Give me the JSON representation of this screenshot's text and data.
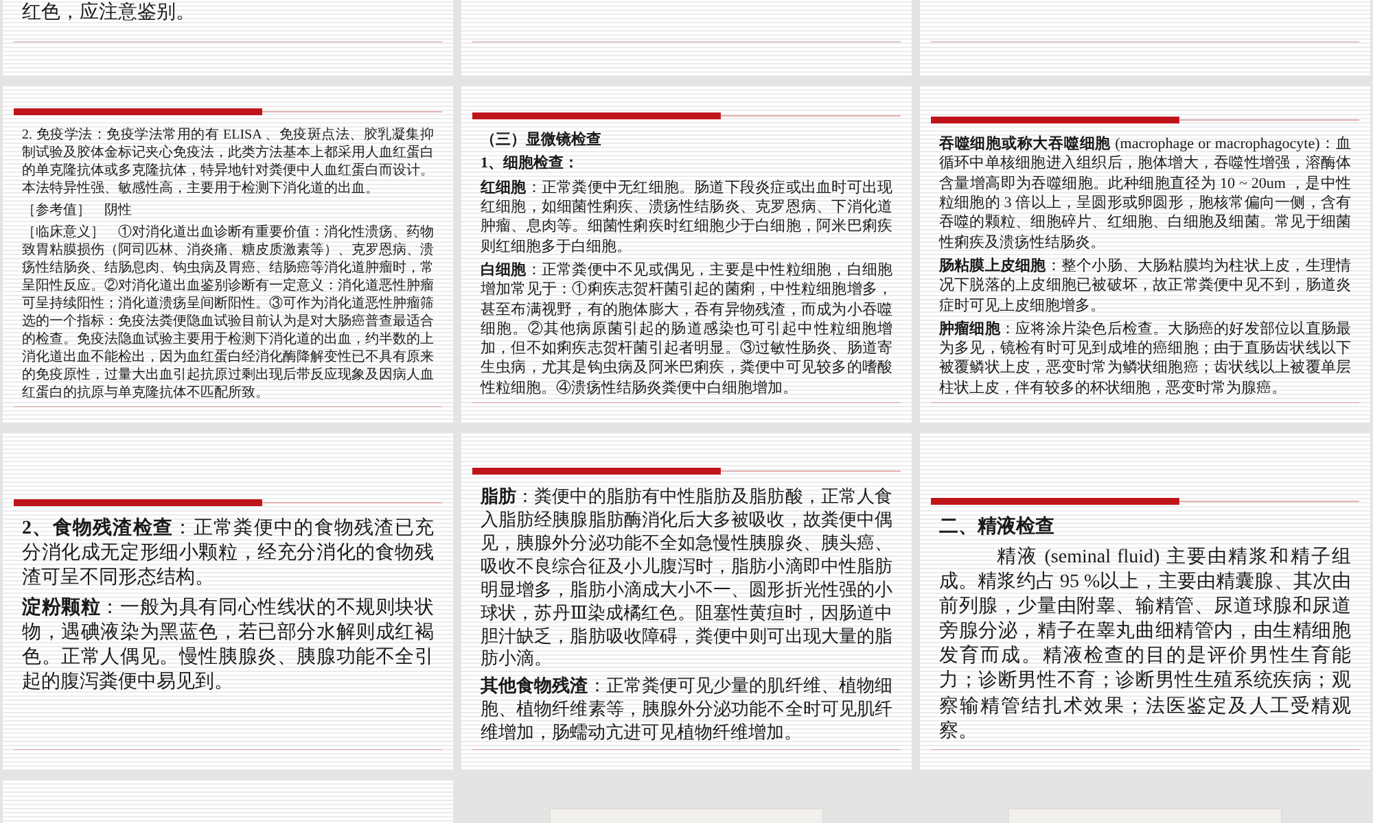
{
  "slides": [
    {
      "kind": "continued",
      "blocks": [
        {
          "kind": "para",
          "text": "红色，应注意鉴别。"
        }
      ]
    },
    {
      "kind": "blank"
    },
    {
      "kind": "blank"
    },
    {
      "kind": "text",
      "blocks": [
        {
          "kind": "para",
          "text": "2. 免疫学法：免疫学法常用的有 ELISA 、免疫斑点法、胶乳凝集抑制试验及胶体金标记夹心免疫法，此类方法基本上都采用人血红蛋白的单克隆抗体或多克隆抗体，特异地针对粪便中人血红蛋白而设计。本法特异性强、敏感性高，主要用于检测下消化道的出血。"
        },
        {
          "kind": "para",
          "text": "［参考值］　阴性"
        },
        {
          "kind": "para",
          "text": "［临床意义］　①对消化道出血诊断有重要价值：消化性溃疡、药物致胃粘膜损伤（阿司匹林、消炎痛、糖皮质激素等）、克罗恩病、溃疡性结肠炎、结肠息肉、钩虫病及胃癌、结肠癌等消化道肿瘤时，常呈阳性反应。②对消化道出血鉴别诊断有一定意义：消化道恶性肿瘤可呈持续阳性；消化道溃疡呈间断阳性。③可作为消化道恶性肿瘤筛选的一个指标：免疫法粪便隐血试验目前认为是对大肠癌普查最适合的检查。免疫法隐血试验主要用于检测下消化道的出血，约半数的上消化道出血不能检出，因为血红蛋白经消化酶降解变性已不具有原来的免疫原性，过量大出血引起抗原过剩出现后带反应现象及因病人血红蛋白的抗原与单克隆抗体不匹配所致。"
        }
      ]
    },
    {
      "kind": "text",
      "blocks": [
        {
          "kind": "heading",
          "text": "（三）显微镜检查"
        },
        {
          "kind": "heading",
          "text": "1、细胞检查："
        },
        {
          "kind": "para",
          "text": "**红细胞**：正常粪便中无红细胞。肠道下段炎症或出血时可出现红细胞，如细菌性痢疾、溃疡性结肠炎、克罗恩病、下消化道肿瘤、息肉等。细菌性痢疾时红细胞少于白细胞，阿米巴痢疾则红细胞多于白细胞。"
        },
        {
          "kind": "para",
          "text": "**白细胞**：正常粪便中不见或偶见，主要是中性粒细胞，白细胞增加常见于：①痢疾志贺杆菌引起的菌痢，中性粒细胞增多，甚至布满视野，有的胞体膨大，吞有异物残渣，而成为小吞噬细胞。②其他病原菌引起的肠道感染也可引起中性粒细胞增加，但不如痢疾志贺杆菌引起者明显。③过敏性肠炎、肠道寄生虫病，尤其是钩虫病及阿米巴痢疾，粪便中可见较多的嗜酸性粒细胞。④溃疡性结肠炎粪便中白细胞增加。"
        }
      ]
    },
    {
      "kind": "text",
      "blocks": [
        {
          "kind": "para",
          "text": "**吞噬细胞或称大吞噬细胞** (macrophage or macrophagocyte)：血循环中单核细胞进入组织后，胞体增大，吞噬性增强，溶酶体含量增高即为吞噬细胞。此种细胞直径为 10 ~ 20um ，是中性粒细胞的 3 倍以上，呈圆形或卵圆形，胞核常偏向一侧，含有吞噬的颗粒、细胞碎片、红细胞、白细胞及细菌。常见于细菌性痢疾及溃疡性结肠炎。"
        },
        {
          "kind": "para",
          "text": "**肠粘膜上皮细胞**：整个小肠、大肠粘膜均为柱状上皮，生理情况下脱落的上皮细胞已被破坏，故正常粪便中见不到，肠道炎症时可见上皮细胞增多。"
        },
        {
          "kind": "para",
          "text": "**肿瘤细胞**：应将涂片染色后检查。大肠癌的好发部位以直肠最为多见，镜检有时可见到成堆的癌细胞；由于直肠齿状线以下被覆鳞状上皮，恶变时常为鳞状细胞癌；齿状线以上被覆单层柱状上皮，伴有较多的杯状细胞，恶变时常为腺癌。"
        }
      ]
    },
    {
      "kind": "text",
      "blocks": [
        {
          "kind": "para",
          "text": "**2、食物残渣检查**：正常粪便中的食物残渣已充分消化成无定形细小颗粒，经充分消化的食物残渣可呈不同形态结构。"
        },
        {
          "kind": "para",
          "text": "**淀粉颗粒**：一般为具有同心性线状的不规则块状物，遇碘液染为黑蓝色，若已部分水解则成红褐色。正常人偶见。慢性胰腺炎、胰腺功能不全引起的腹泻粪便中易见到。"
        }
      ]
    },
    {
      "kind": "text",
      "blocks": [
        {
          "kind": "para",
          "text": "**脂肪**：粪便中的脂肪有中性脂肪及脂肪酸，正常人食入脂肪经胰腺脂肪酶消化后大多被吸收，故粪便中偶见，胰腺外分泌功能不全如急慢性胰腺炎、胰头癌、吸收不良综合征及小儿腹泻时，脂肪小滴即中性脂肪明显增多，脂肪小滴成大小不一、圆形折光性强的小球状，苏丹Ⅲ染成橘红色。阻塞性黄疸时，因肠道中胆汁缺乏，脂肪吸收障碍，粪便中则可出现大量的脂肪小滴。"
        },
        {
          "kind": "para",
          "text": "**其他食物残渣**：正常粪便可见少量的肌纤维、植物细胞、植物纤维素等，胰腺外分泌功能不全时可见肌纤维增加，肠蠕动亢进可见植物纤维增加。"
        }
      ]
    },
    {
      "kind": "text",
      "blocks": [
        {
          "kind": "heading",
          "text": "二、精液检查"
        },
        {
          "kind": "indent",
          "text": "精液 (seminal fluid) 主要由精浆和精子组成。精浆约占 95 %以上，主要由精囊腺、其次由前列腺，少量由附睾、输精管、尿道球腺和尿道旁腺分泌，精子在睾丸曲细精管内，由生精细胞发育而成。精液检查的目的是评价男性生育能力；诊断男性不育；诊断男性生殖系统疾病；观察输精管结扎术效果；法医鉴定及人工受精观察。"
        }
      ]
    },
    {
      "kind": "blank"
    },
    {
      "kind": "figure"
    },
    {
      "kind": "figure"
    }
  ]
}
